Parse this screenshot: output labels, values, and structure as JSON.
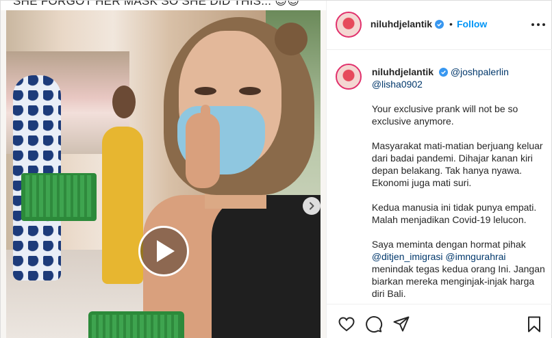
{
  "video": {
    "caption_overlay": "SHE FORGOT HER MASK SO SHE DID THIS... 😎😎",
    "play_icon": "play-icon",
    "next_icon": "chevron-right-icon"
  },
  "header": {
    "username": "niluhdjelantik",
    "separator": "•",
    "follow_label": "Follow",
    "more_icon": "more-dots-icon"
  },
  "comment": {
    "username": "niluhdjelantik",
    "mention1": "@joshpalerlin",
    "mention2": "@lisha0902",
    "p1": "Your exclusive prank will not be so exclusive anymore.",
    "p2": "Masyarakat mati-matian berjuang keluar dari badai pandemi. Dihajar kanan kiri depan belakang. Tak hanya nyawa. Ekonomi juga mati suri.",
    "p3": "Kedua manusia ini tidak punya empati. Malah menjadikan Covid-19 lelucon.",
    "p4_intro": "Saya meminta dengan hormat pihak",
    "mention3": "@ditjen_imigrasi",
    "mention4": "@imngurahrai",
    "p4_rest": "menindak tegas kedua orang Ini. Jangan biarkan mereka menginjak-injak harga diri Bali."
  },
  "actions": {
    "like_icon": "heart-icon",
    "comment_icon": "comment-bubble-icon",
    "share_icon": "paper-plane-icon",
    "save_icon": "bookmark-icon"
  },
  "colors": {
    "link_blue": "#0095f6",
    "mention_blue": "#00376b",
    "verified_blue": "#3897f0",
    "text": "#262626"
  }
}
